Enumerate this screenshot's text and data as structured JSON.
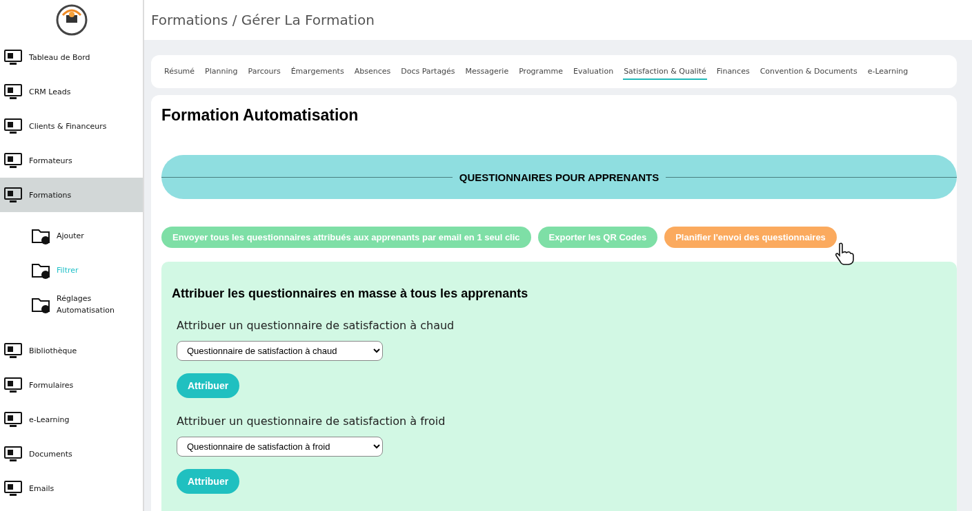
{
  "breadcrumb": "Formations / Gérer La Formation",
  "sidebar": {
    "items": [
      {
        "label": "Tableau de Bord",
        "selected": false
      },
      {
        "label": "CRM Leads",
        "selected": false
      },
      {
        "label": "Clients & Financeurs",
        "selected": false
      },
      {
        "label": "Formateurs",
        "selected": false
      },
      {
        "label": "Formations",
        "selected": true,
        "children": [
          {
            "label": "Ajouter",
            "selected": false
          },
          {
            "label": "Filtrer",
            "selected": true
          },
          {
            "label": "Réglages Automatisation",
            "selected": false
          }
        ]
      },
      {
        "label": "Bibliothèque",
        "selected": false
      },
      {
        "label": "Formulaires",
        "selected": false
      },
      {
        "label": "e-Learning",
        "selected": false
      },
      {
        "label": "Documents",
        "selected": false
      },
      {
        "label": "Emails",
        "selected": false
      }
    ]
  },
  "tabs": [
    {
      "label": "Résumé",
      "selected": false
    },
    {
      "label": "Planning",
      "selected": false
    },
    {
      "label": "Parcours",
      "selected": false
    },
    {
      "label": "Émargements",
      "selected": false
    },
    {
      "label": "Absences",
      "selected": false
    },
    {
      "label": "Docs Partagés",
      "selected": false
    },
    {
      "label": "Messagerie",
      "selected": false
    },
    {
      "label": "Programme",
      "selected": false
    },
    {
      "label": "Evaluation",
      "selected": false
    },
    {
      "label": "Satisfaction & Qualité",
      "selected": true
    },
    {
      "label": "Finances",
      "selected": false
    },
    {
      "label": "Convention & Documents",
      "selected": false
    },
    {
      "label": "e-Learning",
      "selected": false
    }
  ],
  "title": "Formation Automatisation",
  "section_banner": "QUESTIONNAIRES POUR APPRENANTS",
  "actions": [
    {
      "label": "Envoyer tous les questionnaires attribués aux apprenants par email en 1 seul clic",
      "kind": "green"
    },
    {
      "label": "Exporter les QR Codes",
      "kind": "green"
    },
    {
      "label": "Planifier l'envoi des questionnaires",
      "kind": "orange"
    }
  ],
  "assign_panel": {
    "title": "Attribuer les questionnaires en masse à tous les apprenants",
    "groups": [
      {
        "label": "Attribuer un questionnaire de satisfaction à chaud",
        "value": "Questionnaire de satisfaction à chaud",
        "button": "Attribuer"
      },
      {
        "label": "Attribuer un questionnaire de satisfaction à froid",
        "value": "Questionnaire de satisfaction à froid",
        "button": "Attribuer"
      }
    ]
  }
}
